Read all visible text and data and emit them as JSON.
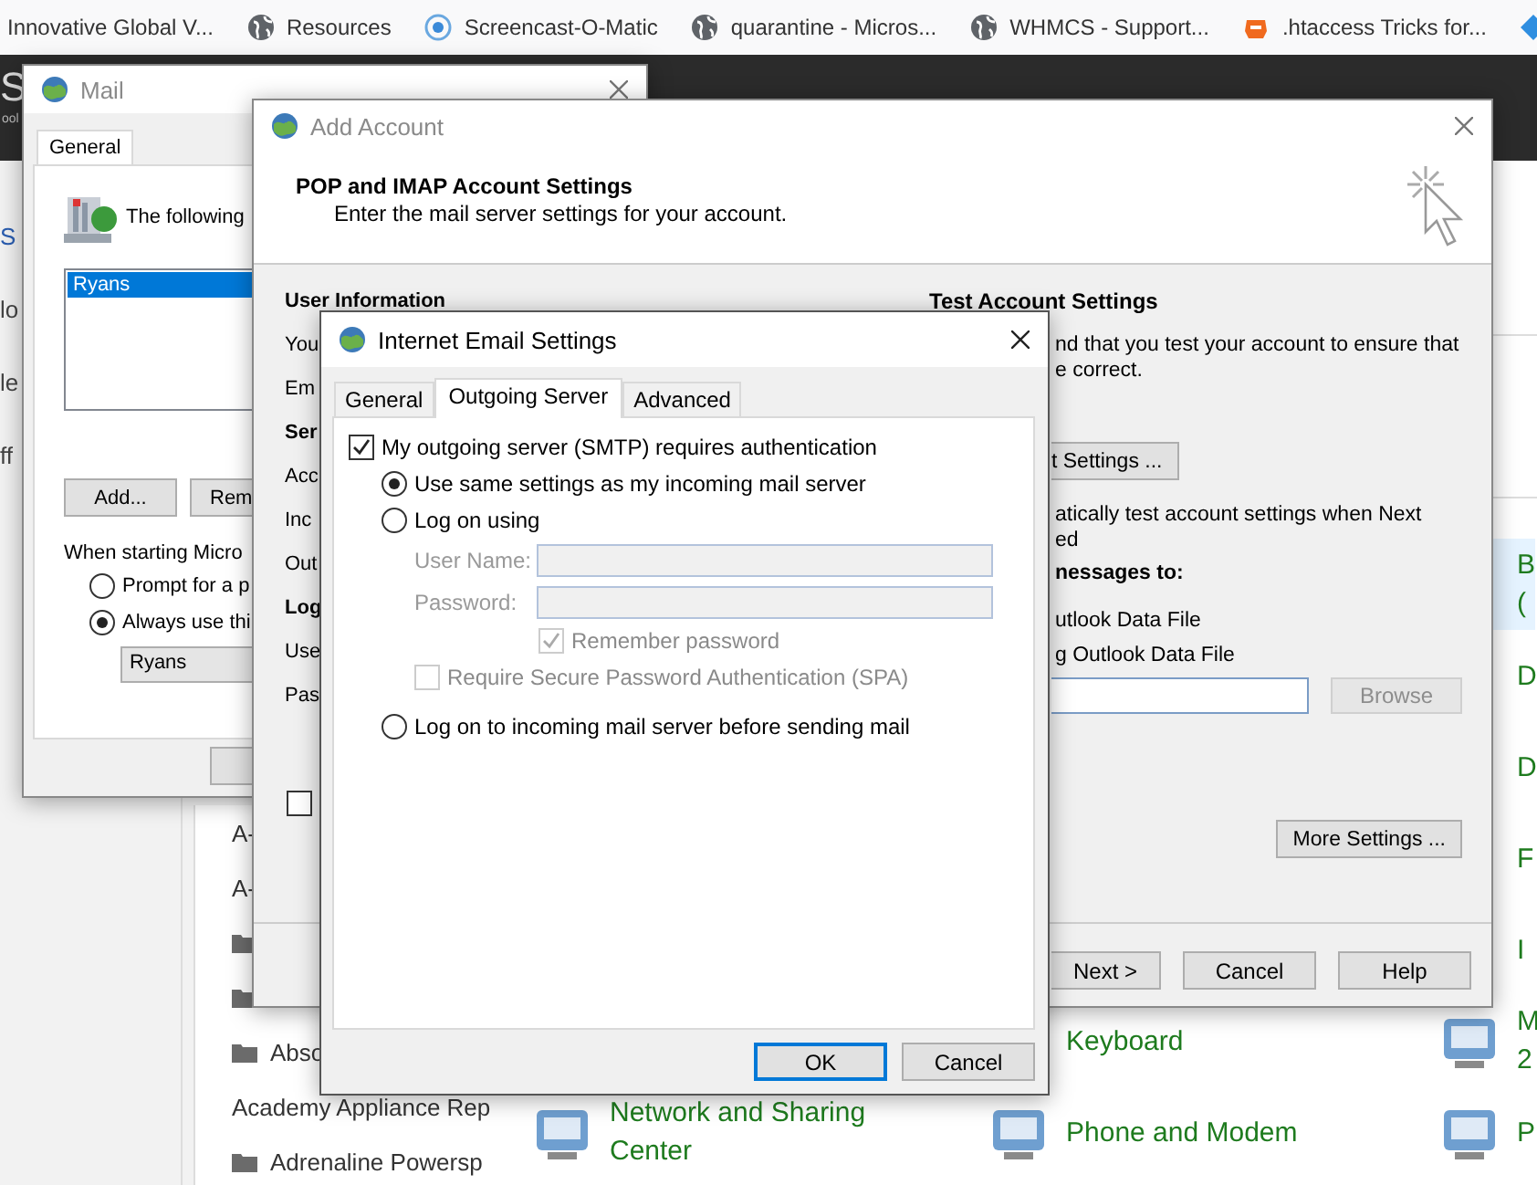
{
  "bookmarks": [
    {
      "kind": "none",
      "label": "Innovative Global V..."
    },
    {
      "kind": "globe",
      "label": "Resources"
    },
    {
      "kind": "ring",
      "label": "Screencast-O-Matic"
    },
    {
      "kind": "globe",
      "label": "quarantine - Micros..."
    },
    {
      "kind": "globe",
      "label": "WHMCS - Support..."
    },
    {
      "kind": "stamp",
      "label": ".htaccess Tricks for..."
    },
    {
      "kind": "diamond"
    }
  ],
  "site_header": {
    "logo": "S",
    "tagline": "ool"
  },
  "side_links": [
    {
      "kind": "link",
      "text": "S"
    },
    {
      "kind": "plain",
      "text": "lo"
    },
    {
      "kind": "plain",
      "text": "le"
    },
    {
      "kind": "plain",
      "text": "ff"
    }
  ],
  "files": [
    {
      "kind": "plain",
      "label": "A-"
    },
    {
      "kind": "plain",
      "label": "A-"
    },
    {
      "kind": "folder"
    },
    {
      "kind": "folder"
    },
    {
      "kind": "folder",
      "label": "Abso"
    },
    {
      "kind": "plain",
      "label": "Academy Appliance Rep"
    },
    {
      "kind": "folder",
      "label": "Adrenaline Powersp"
    }
  ],
  "control_panel": {
    "columns": [
      {
        "items": [
          {
            "lines": [
              "Network and Sharing",
              "Center"
            ],
            "selected": false
          }
        ]
      },
      {
        "items": [
          {
            "lines": [
              "Keyboard"
            ],
            "selected": false
          },
          {
            "lines": [
              "Phone and Modem"
            ],
            "selected": false
          }
        ]
      },
      {
        "items": [
          {
            "lines": [
              "B",
              "("
            ],
            "selected": true
          },
          {
            "lines": [
              "D"
            ],
            "selected": false
          },
          {
            "lines": [
              "D"
            ],
            "selected": false
          },
          {
            "lines": [
              "F"
            ],
            "selected": false
          },
          {
            "lines": [
              "I"
            ],
            "selected": false
          },
          {
            "lines": [
              "M",
              "2"
            ],
            "selected": false
          },
          {
            "lines": [
              "P"
            ],
            "selected": false
          }
        ]
      }
    ]
  },
  "mail_window": {
    "title": "Mail",
    "tab": "General",
    "intro": "The following",
    "accounts": [
      {
        "name": "Ryans",
        "selected": true
      }
    ],
    "buttons": [
      "Add...",
      "Rem"
    ],
    "startup_label": "When starting Micro",
    "startup_options": [
      {
        "label": "Prompt for a p",
        "selected": false
      },
      {
        "label": "Always use thi",
        "selected": true
      }
    ],
    "profile": "Ryans"
  },
  "add_account": {
    "title": "Add Account",
    "heading": "POP and IMAP Account Settings",
    "subheading": "Enter the mail server settings for your account.",
    "left_labels": [
      {
        "kind": "section",
        "text": "User Information"
      },
      {
        "kind": "label",
        "text": "You"
      },
      {
        "kind": "label",
        "text": "Em"
      },
      {
        "kind": "section",
        "text": "Ser"
      },
      {
        "kind": "label",
        "text": "Acc"
      },
      {
        "kind": "label",
        "text": "Inc"
      },
      {
        "kind": "label",
        "text": "Out"
      },
      {
        "kind": "section",
        "text": "Log"
      },
      {
        "kind": "label",
        "text": "Use"
      },
      {
        "kind": "label",
        "text": "Pas"
      }
    ],
    "bottom_checkbox": {
      "checked": false
    },
    "test_heading": "Test Account Settings",
    "test_lines": [
      "nd that you test your account to ensure that",
      "e correct."
    ],
    "test_button": "t Settings ...",
    "auto_test_lines": [
      "atically test account settings when Next",
      "ed"
    ],
    "deliver_heading": "nessages to:",
    "deliver_options": [
      "utlook Data File",
      "g Outlook Data File"
    ],
    "browse": {
      "label": "Browse",
      "disabled": true
    },
    "more_settings": "More Settings ...",
    "footer_buttons": [
      "Next >",
      "Cancel",
      "Help"
    ]
  },
  "internet_email": {
    "title": "Internet Email Settings",
    "tabs": [
      {
        "label": "General",
        "selected": false
      },
      {
        "label": "Outgoing Server",
        "selected": true
      },
      {
        "label": "Advanced",
        "selected": false
      }
    ],
    "requires_auth": {
      "label": "My outgoing server (SMTP) requires authentication",
      "checked": true
    },
    "auth_options": [
      {
        "label": "Use same settings as my incoming mail server",
        "selected": true
      },
      {
        "label": "Log on using",
        "selected": false
      },
      {
        "label": "Log on to incoming mail server before sending mail",
        "selected": false
      }
    ],
    "credentials": {
      "disabled": true,
      "fields": [
        "User Name:",
        "Password:"
      ],
      "remember": {
        "label": "Remember password",
        "checked": true
      },
      "spa": {
        "label": "Require Secure Password Authentication (SPA)",
        "checked": false
      }
    },
    "buttons": [
      {
        "label": "OK",
        "default": true
      },
      {
        "label": "Cancel",
        "default": false
      }
    ]
  }
}
